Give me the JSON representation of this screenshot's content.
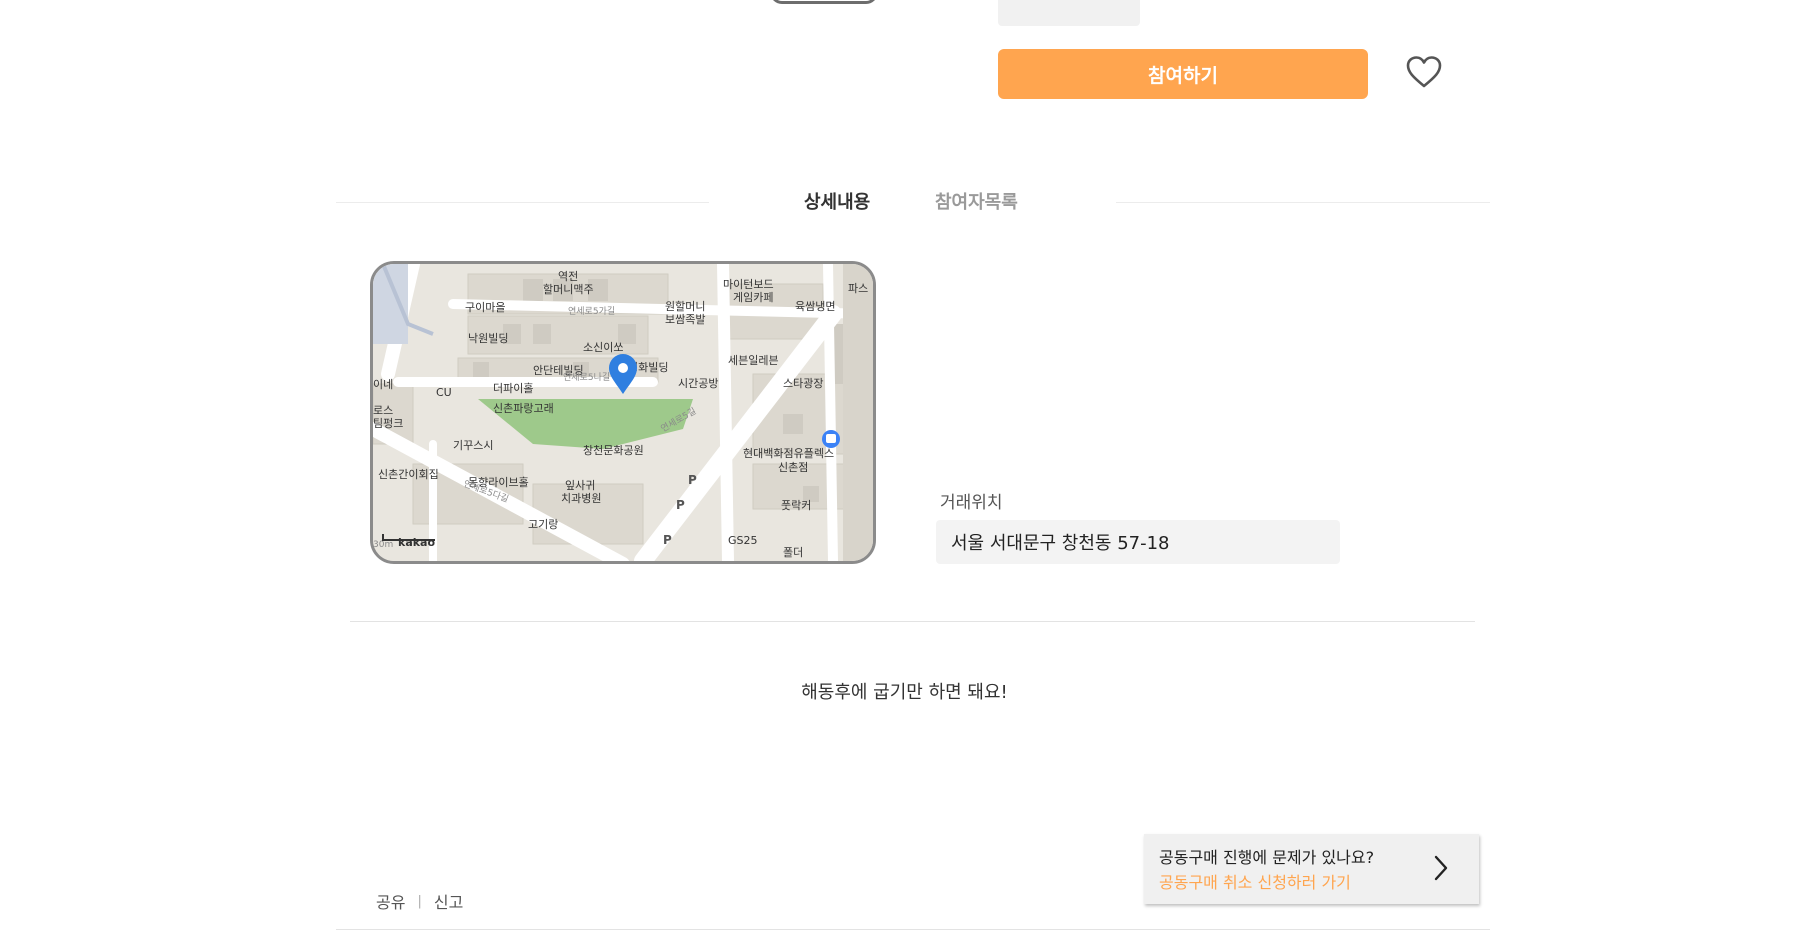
{
  "actions": {
    "join_label": "참여하기",
    "like_icon": "heart-outline-icon",
    "accent_color": "#ffa54f"
  },
  "tabs": [
    {
      "label": "상세내용",
      "active": true
    },
    {
      "label": "참여자목록",
      "active": false
    }
  ],
  "map": {
    "provider": "kakao",
    "scale": "30m",
    "marker_icon": "map-pin-icon",
    "places": [
      "역전",
      "할머니맥주",
      "원할머니",
      "보쌈족발",
      "마이턴보드",
      "게임카페",
      "육쌈냉면",
      "구이마을",
      "낙원빌딩",
      "소신이쏘",
      "세븐일레븐",
      "안단테빌딩",
      "영화빌딩",
      "시간공방",
      "스타광장",
      "더파이홀",
      "CU",
      "신촌파랑고래",
      "창천문화공원",
      "기꾸스시",
      "현대백화점유플렉스",
      "신촌점",
      "신촌간이회집",
      "몽향라이브홀",
      "잎사귀",
      "치과병원",
      "고기랑",
      "풋락커",
      "GS25",
      "폴더",
      "연세로5가길",
      "연세로5다길",
      "파스",
      "이네",
      "로스",
      "팀펑크"
    ]
  },
  "location": {
    "label": "거래위치",
    "address": "서울 서대문구 창천동 57-18"
  },
  "description": "해동후에 굽기만 하면 돼요!",
  "problem": {
    "question": "공동구매 진행에 문제가 있나요?",
    "link_text": "공동구매 취소 신청하러 가기",
    "arrow_icon": "chevron-right-icon"
  },
  "footer": {
    "share": "공유",
    "report": "신고"
  }
}
